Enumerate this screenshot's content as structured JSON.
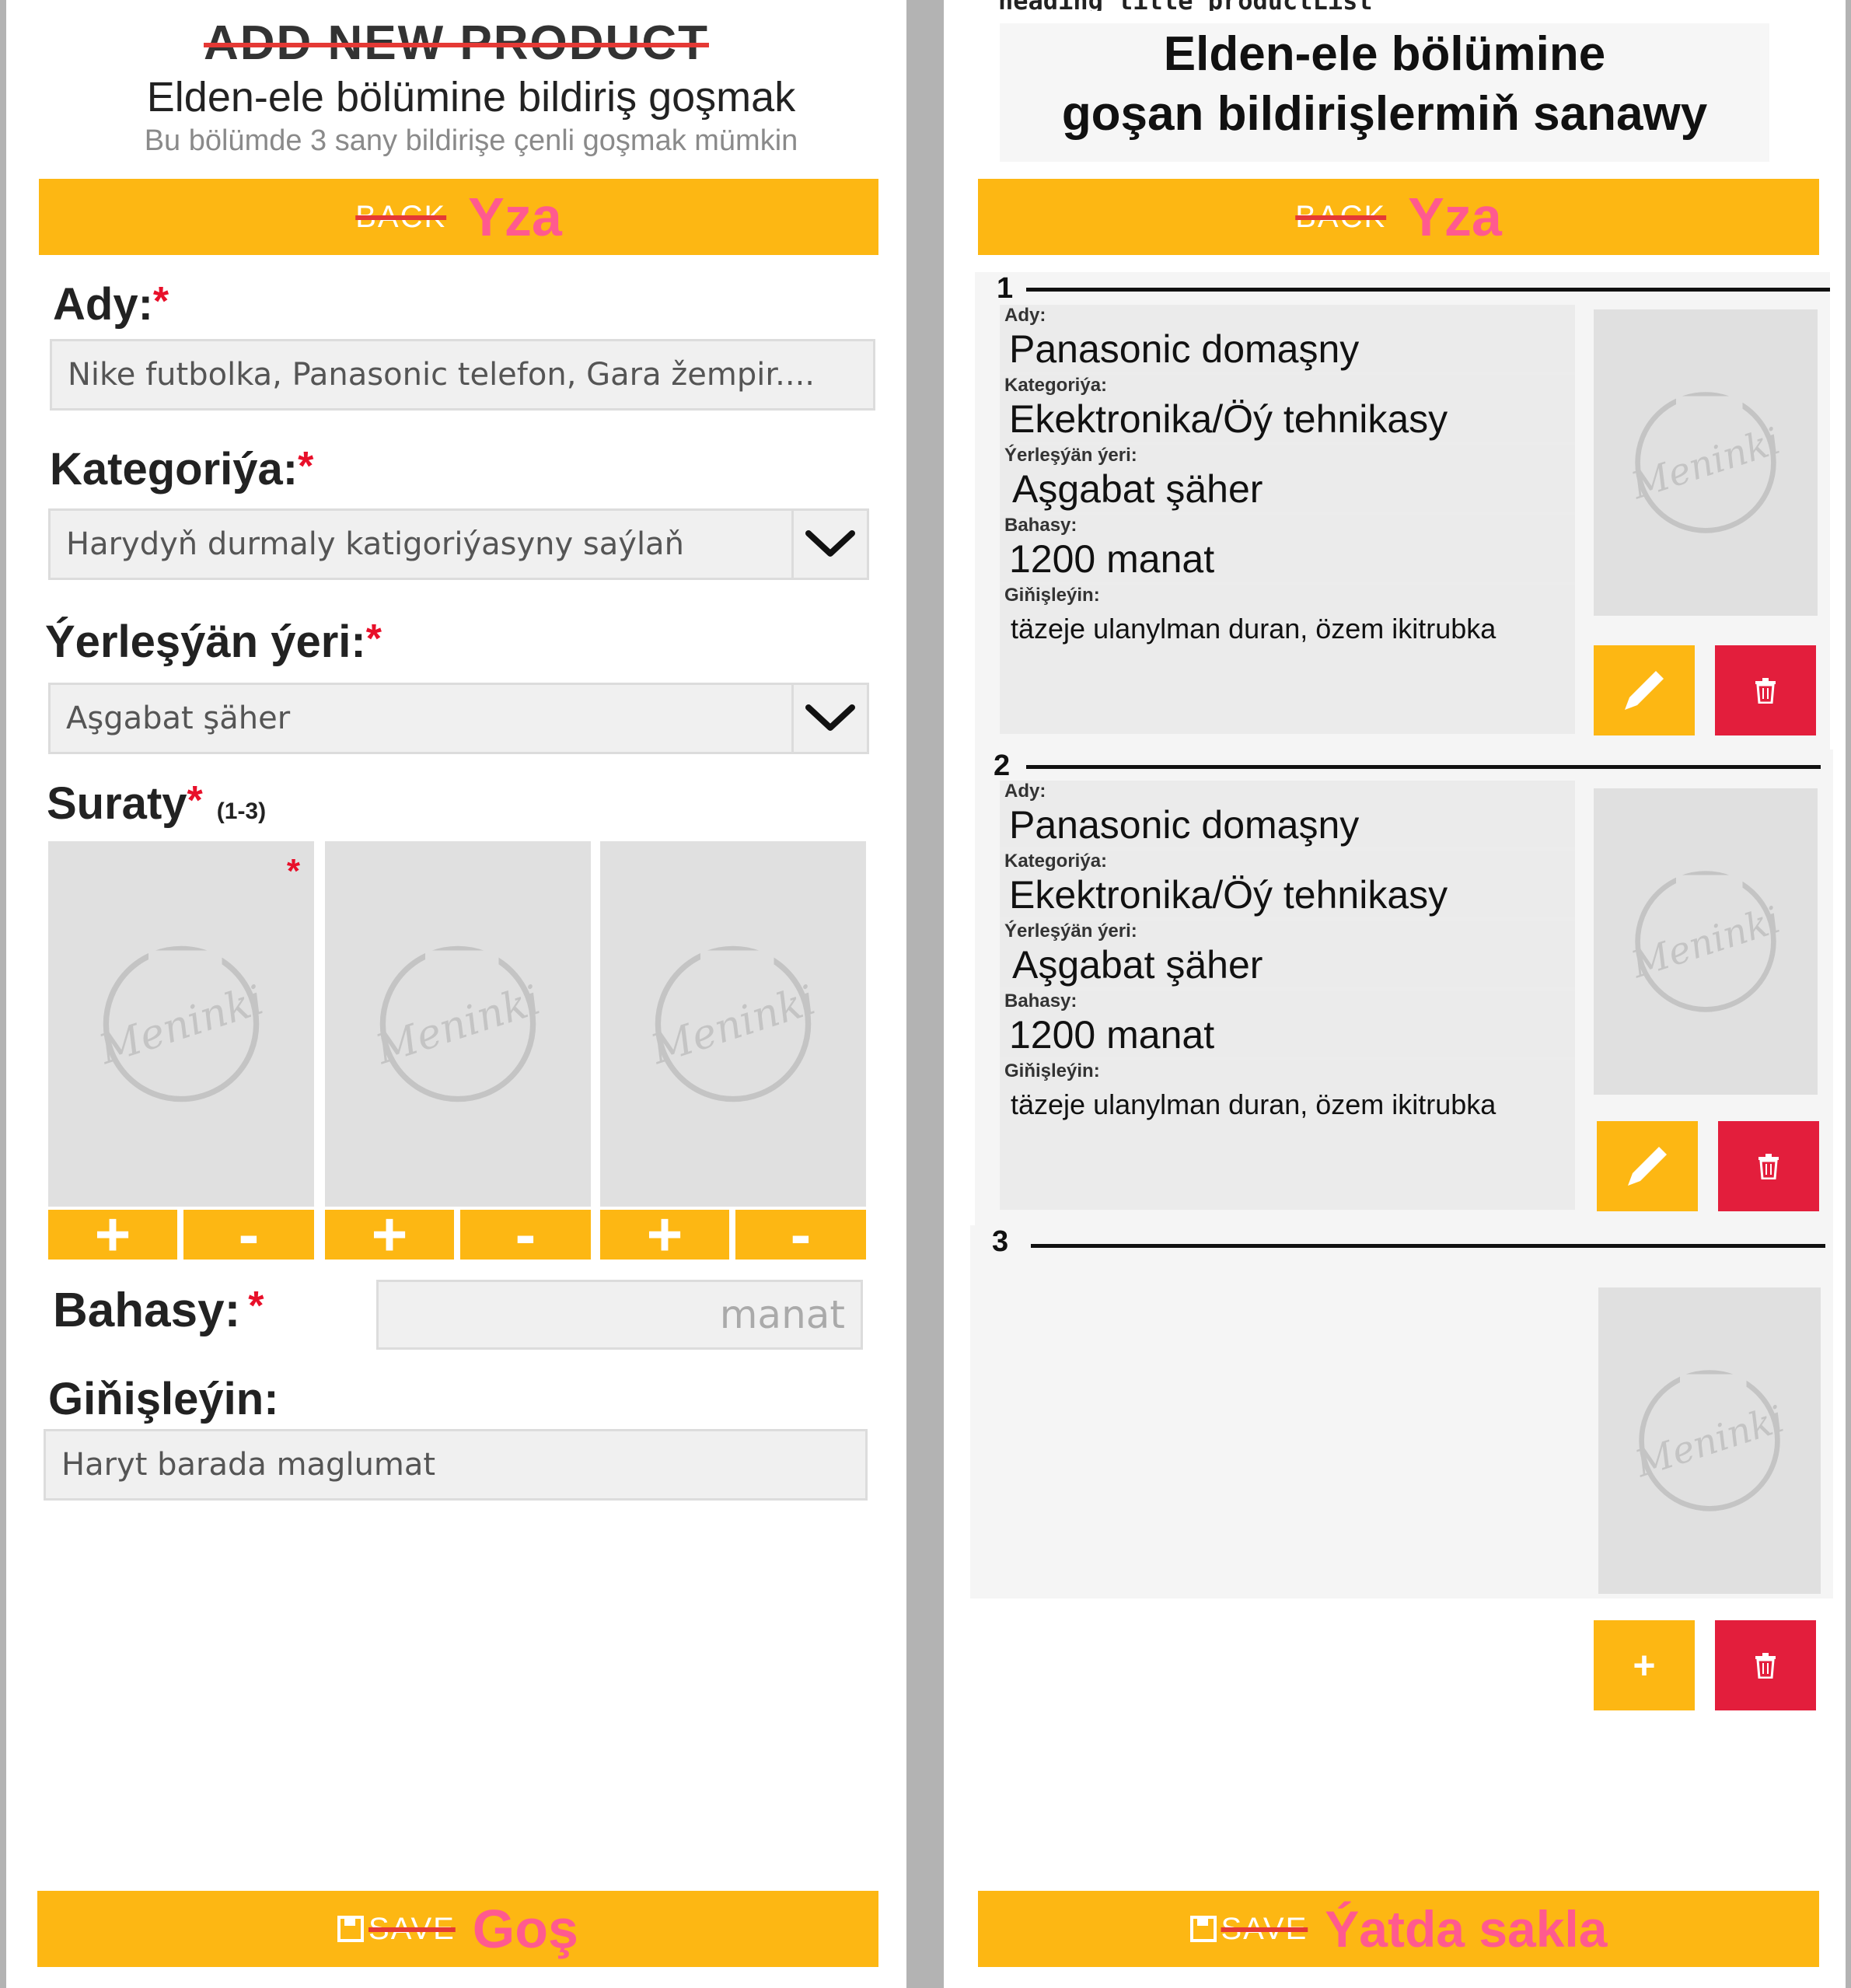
{
  "left": {
    "header": {
      "title_en": "ADD NEW PRODUCT",
      "title_tk": "Elden-ele bölümine bildiriş goşmak",
      "subtitle": "Bu bölümde 3 sany bildirişe çenli goşmak mümkin"
    },
    "back": {
      "en": "BACK",
      "tk": "Yza"
    },
    "name": {
      "label": "Ady:",
      "required": "*",
      "placeholder": "Nike futbolka, Panasonic telefon, Gara žempir...."
    },
    "category": {
      "label": "Kategoriýa:",
      "required": "*",
      "placeholder": "Harydyň durmaly katigoriýasyny saýlaň"
    },
    "location": {
      "label": "Ýerleşýän ýeri:",
      "required": "*",
      "value": "Aşgabat şäher"
    },
    "photos": {
      "label": "Suraty",
      "required": "*",
      "range": "(1-3)",
      "plus": "+",
      "minus": "-",
      "first_required": "*",
      "watermark": "Meninki"
    },
    "price": {
      "label": "Bahasy:",
      "required": "*",
      "placeholder": "manat"
    },
    "description": {
      "label": "Giňişleýin:",
      "placeholder": "Haryt barada maglumat"
    },
    "save": {
      "en": "SAVE",
      "tk": "Goş"
    }
  },
  "right": {
    "header": {
      "overlay_label": "heading_title_productList",
      "title_line1": "Elden-ele bölümine",
      "title_line2": "goşan bildirişlermiň sanawy"
    },
    "back": {
      "en": "BACK",
      "tk": "Yza"
    },
    "items": [
      {
        "number": "1",
        "name_label": "Ady:",
        "name": "Panasonic domaşny",
        "category_label": "Kategoriýa:",
        "category": "Ekektronika/Öý tehnikasy",
        "location_label": "Ýerleşýän ýeri:",
        "location": "Aşgabat şäher",
        "price_label": "Bahasy:",
        "price": "1200 manat",
        "description_label": "Giňişleýin:",
        "description": "täzeje ulanylman duran, özem ikitrubka"
      },
      {
        "number": "2",
        "name_label": "Ady:",
        "name": "Panasonic domaşny",
        "category_label": "Kategoriýa:",
        "category": "Ekektronika/Öý tehnikasy",
        "location_label": "Ýerleşýän ýeri:",
        "location": "Aşgabat şäher",
        "price_label": "Bahasy:",
        "price": "1200 manat",
        "description_label": "Giňişleýin:",
        "description": "täzeje ulanylman duran, özem ikitrubka"
      },
      {
        "number": "3",
        "add": "+"
      }
    ],
    "save": {
      "en": "SAVE",
      "tk": "Ýatda sakla"
    }
  },
  "colors": {
    "accent": "#fdb713",
    "delete": "#e31e3c",
    "pink_text": "#ff5a8f",
    "required": "#e8102a"
  },
  "icons": [
    "chevron-down-icon",
    "pencil-icon",
    "trash-icon",
    "floppy-icon",
    "watermark-logo"
  ]
}
